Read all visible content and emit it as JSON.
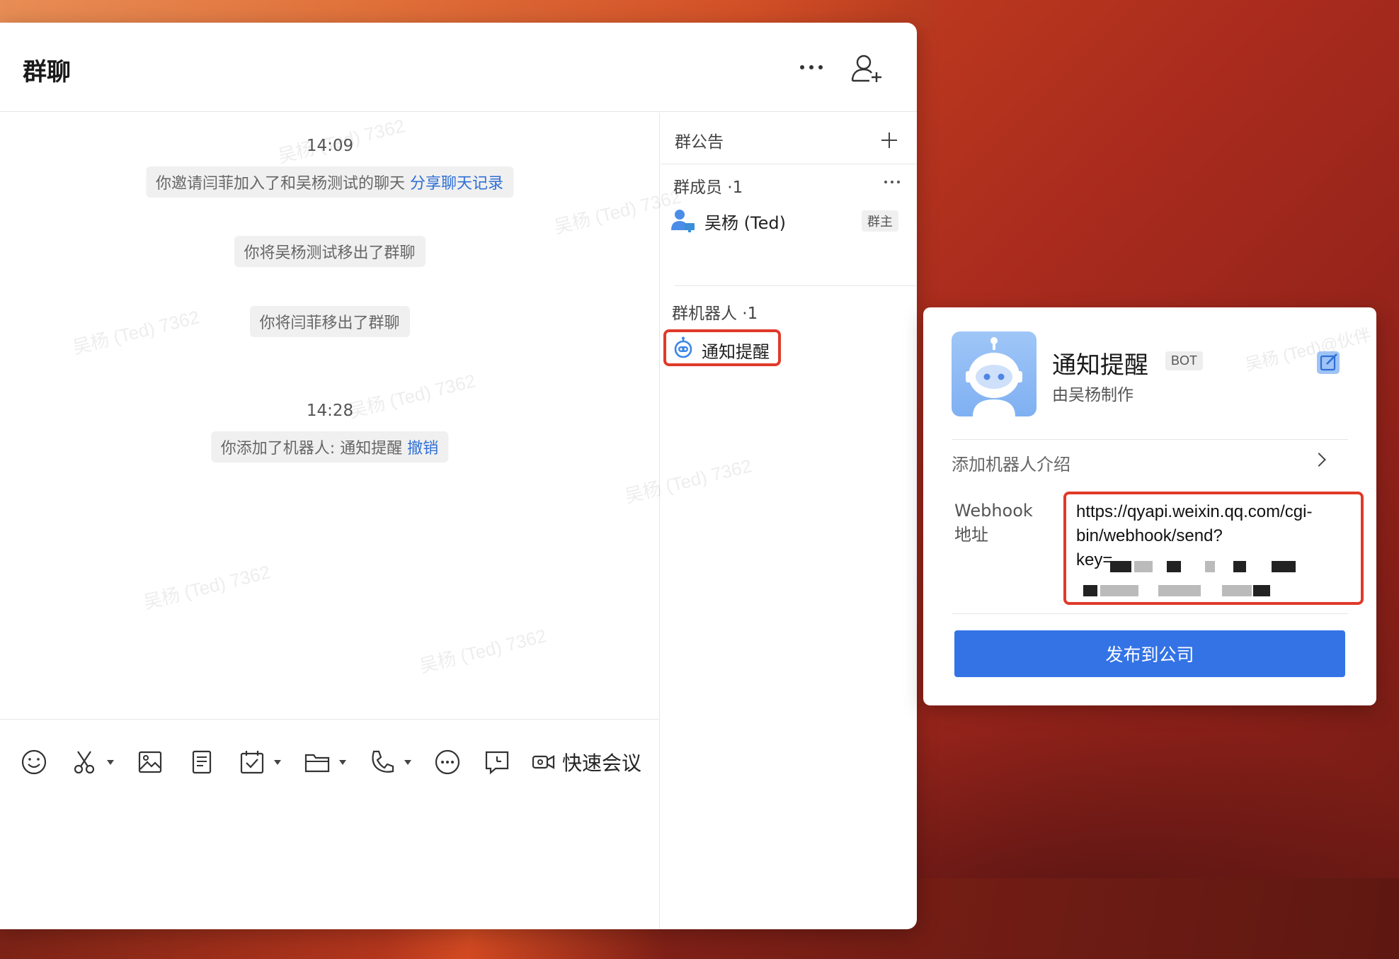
{
  "window": {
    "title": "群聊"
  },
  "chat": {
    "messages": [
      {
        "type": "time",
        "text": "14:09"
      },
      {
        "type": "system",
        "text": "你邀请闫菲加入了和吴杨测试的聊天",
        "link": "分享聊天记录"
      },
      {
        "type": "system",
        "text": "你将吴杨测试移出了群聊"
      },
      {
        "type": "system",
        "text": "你将闫菲移出了群聊"
      },
      {
        "type": "time",
        "text": "14:28"
      },
      {
        "type": "system",
        "text": "你添加了机器人: 通知提醒",
        "link": "撤销"
      }
    ],
    "watermark": "吴杨 (Ted) 7362"
  },
  "toolbar": {
    "icons": [
      "emoji-icon",
      "scissors-icon",
      "image-icon",
      "document-icon",
      "task-icon",
      "folder-icon",
      "phone-icon",
      "more-icon",
      "message-icon",
      "video-icon"
    ],
    "meeting_label": "快速会议"
  },
  "side_panel": {
    "announcement_title": "群公告",
    "members_title": "群成员 ·1",
    "members": [
      {
        "name": "吴杨 (Ted)",
        "badge": "群主"
      }
    ],
    "bots_title": "群机器人 ·1",
    "bots": [
      {
        "name": "通知提醒"
      }
    ]
  },
  "bot_card": {
    "name": "通知提醒",
    "badge": "BOT",
    "maker": "由吴杨制作",
    "intro_label": "添加机器人介绍",
    "webhook_label_1": "Webhook",
    "webhook_label_2": "地址",
    "webhook_url_line1": "https://qyapi.weixin.qq.com/cgi-",
    "webhook_url_line2": "bin/webhook/send?",
    "webhook_url_line3": "key=",
    "publish_label": "发布到公司",
    "watermark": "吴杨 (Ted)@伙伴"
  },
  "colors": {
    "accent": "#3473e6",
    "highlight": "#e03a2a",
    "link": "#2f6fd6"
  }
}
